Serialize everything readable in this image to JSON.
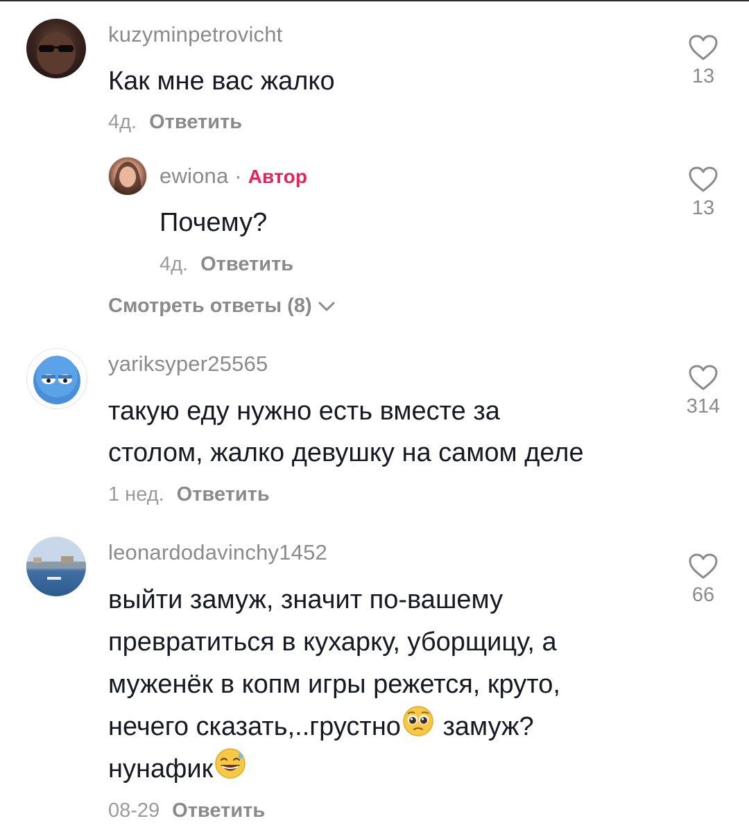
{
  "comments": [
    {
      "username": "kuzyminpetrovicht",
      "text_lines": [
        "Как мне вас жалко"
      ],
      "date": "4д.",
      "reply_label": "Ответить",
      "likes": "13",
      "reply": {
        "username": "ewiona",
        "separator": "·",
        "author_badge": "Автор",
        "text": "Почему?",
        "date": "4д.",
        "reply_label": "Ответить",
        "likes": "13"
      },
      "view_replies": "Смотреть ответы (8)"
    },
    {
      "username": "yariksyper25565",
      "text_lines": [
        "такую еду нужно есть вместе за",
        "столом, жалко девушку на самом деле"
      ],
      "date": "1 нед.",
      "reply_label": "Ответить",
      "likes": "314"
    },
    {
      "username": "leonardodavinchy1452",
      "text_lines": [
        "выйти замуж, значит по-вашему",
        "превратиться в кухарку, уборщицу, а",
        "муженёк в копм игры режется, круто,",
        "нечего сказать,..грустно",
        "замуж?",
        "нунафик"
      ],
      "emojis": [
        "pleading-face-emoji",
        "grinning-sweat-emoji"
      ],
      "date": "08-29",
      "reply_label": "Ответить",
      "likes": "66"
    }
  ],
  "colors": {
    "text": "#161823",
    "muted": "#8a8a8a",
    "author": "#e4245a"
  }
}
